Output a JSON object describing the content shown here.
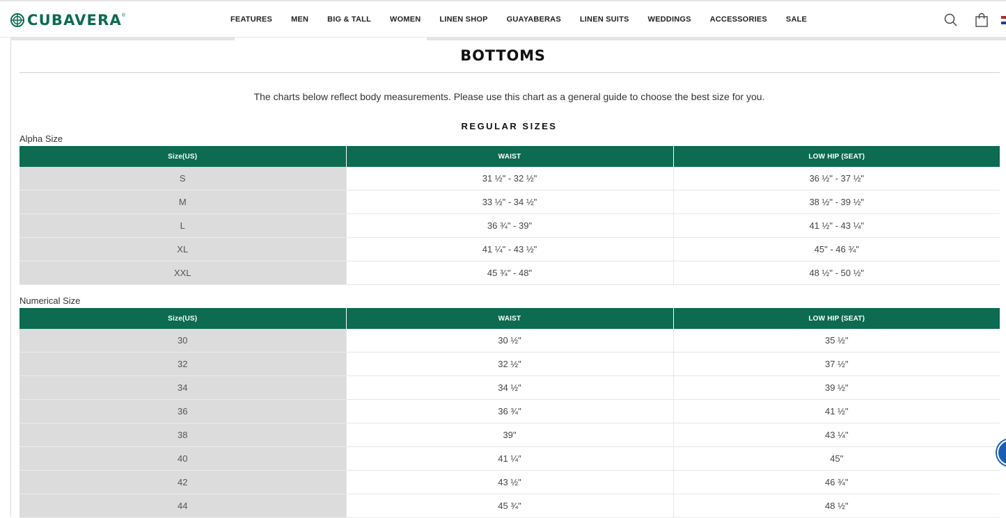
{
  "brand": {
    "name": "CUBAVERA",
    "reg": "®",
    "color": "#0c6b50"
  },
  "nav": [
    {
      "label": "FEATURES"
    },
    {
      "label": "MEN"
    },
    {
      "label": "BIG & TALL"
    },
    {
      "label": "WOMEN"
    },
    {
      "label": "LINEN SHOP"
    },
    {
      "label": "GUAYABERAS"
    },
    {
      "label": "LINEN SUITS"
    },
    {
      "label": "WEDDINGS"
    },
    {
      "label": "ACCESSORIES"
    },
    {
      "label": "SALE"
    }
  ],
  "header_icons": [
    "search-icon",
    "shopping-bag-icon",
    "us-flag-icon"
  ],
  "page": {
    "title": "BOTTOMS",
    "intro": "The charts below reflect body measurements. Please use this chart as a general guide to choose the best size for you.",
    "section": "REGULAR SIZES"
  },
  "alpha": {
    "label": "Alpha Size",
    "headers": [
      "Size(US)",
      "WAIST",
      "LOW HIP (SEAT)"
    ],
    "rows": [
      [
        "S",
        "31 ½\" - 32 ½\"",
        "36 ½\" - 37 ½\""
      ],
      [
        "M",
        "33 ½\" - 34 ½\"",
        "38 ½\" - 39 ½\""
      ],
      [
        "L",
        "36 ¾\" - 39\"",
        "41 ½\" - 43 ¼\""
      ],
      [
        "XL",
        "41 ¼\" - 43 ½\"",
        "45\" - 46 ¾\""
      ],
      [
        "XXL",
        "45 ¾\" - 48\"",
        "48 ½\" - 50 ½\""
      ]
    ]
  },
  "numerical": {
    "label": "Numerical Size",
    "headers": [
      "Size(US)",
      "WAIST",
      "LOW HIP (SEAT)"
    ],
    "rows": [
      [
        "30",
        "30 ½\"",
        "35 ½\""
      ],
      [
        "32",
        "32 ½\"",
        "37 ½\""
      ],
      [
        "34",
        "34 ½\"",
        "39 ½\""
      ],
      [
        "36",
        "36 ¾\"",
        "41 ½\""
      ],
      [
        "38",
        "39\"",
        "43 ¼\""
      ],
      [
        "40",
        "41 ¼\"",
        "45\""
      ],
      [
        "42",
        "43 ½\"",
        "46 ¾\""
      ],
      [
        "44",
        "45 ¾\"",
        "48 ½\""
      ]
    ]
  },
  "colors": {
    "table_header": "#0c6b50",
    "size_column": "#dcdcdc"
  }
}
